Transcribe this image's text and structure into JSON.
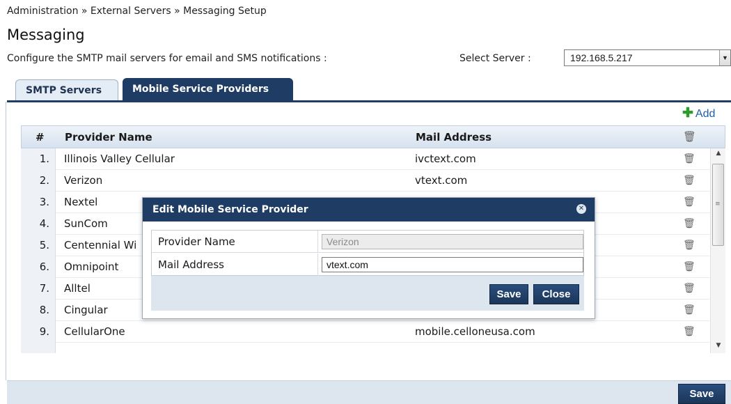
{
  "breadcrumb": "Administration » External Servers » Messaging Setup",
  "page": {
    "title": "Messaging",
    "description": "Configure the SMTP mail servers for email and SMS notifications :",
    "select_label": "Select Server :",
    "selected_server": "192.168.5.217"
  },
  "tabs": [
    {
      "label": "SMTP Servers",
      "active": false
    },
    {
      "label": "Mobile Service Providers",
      "active": true
    }
  ],
  "add_label": "Add",
  "table": {
    "columns": [
      "#",
      "Provider Name",
      "Mail Address"
    ],
    "rows": [
      {
        "num": "1.",
        "name": "Illinois Valley Cellular",
        "mail": "ivctext.com"
      },
      {
        "num": "2.",
        "name": "Verizon",
        "mail": "vtext.com"
      },
      {
        "num": "3.",
        "name": "Nextel",
        "mail": ""
      },
      {
        "num": "4.",
        "name": "SunCom",
        "mail": ""
      },
      {
        "num": "5.",
        "name": "Centennial Wi",
        "mail": ""
      },
      {
        "num": "6.",
        "name": "Omnipoint",
        "mail": ""
      },
      {
        "num": "7.",
        "name": "Alltel",
        "mail": ""
      },
      {
        "num": "8.",
        "name": "Cingular",
        "mail": ""
      },
      {
        "num": "9.",
        "name": "CellularOne",
        "mail": "mobile.celloneusa.com"
      }
    ]
  },
  "footer": {
    "save_label": "Save"
  },
  "dialog": {
    "title": "Edit Mobile Service Provider",
    "fields": [
      {
        "label": "Provider Name",
        "value": "Verizon",
        "disabled": true
      },
      {
        "label": "Mail Address",
        "value": "vtext.com",
        "disabled": false
      }
    ],
    "save_label": "Save",
    "close_label": "Close"
  },
  "colors": {
    "accent": "#1f3c64",
    "panel": "#dde6ef",
    "add_green": "#2e9a2a"
  }
}
